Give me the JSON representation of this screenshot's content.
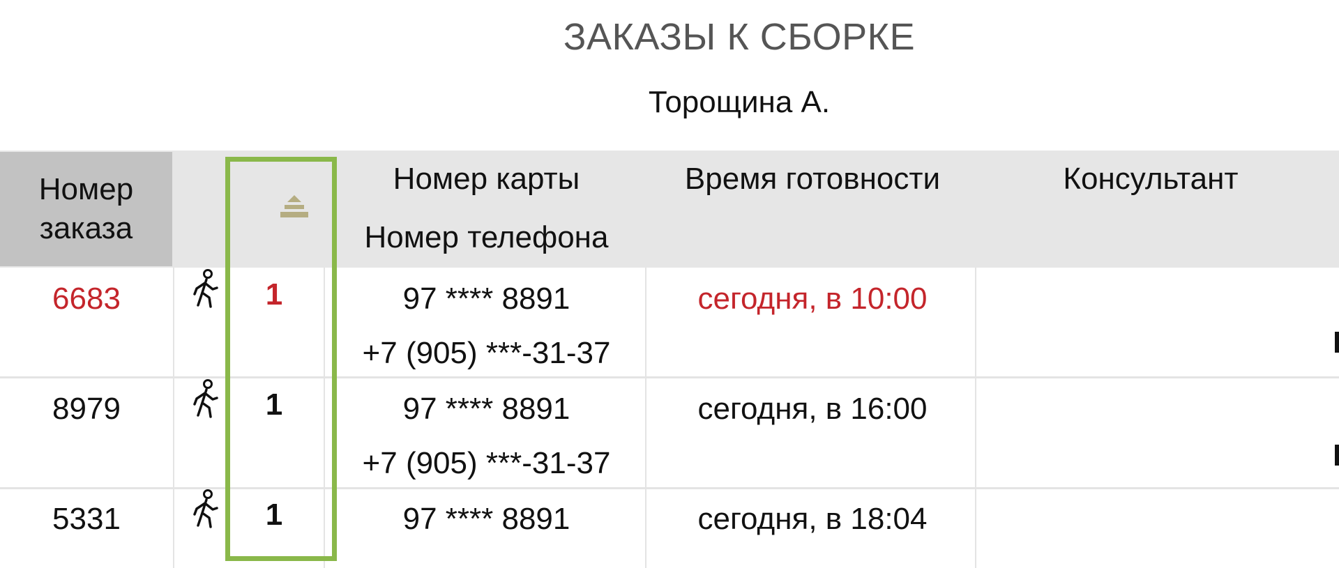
{
  "page": {
    "title": "ЗАКАЗЫ К СБОРКЕ",
    "employee": "Торощина А."
  },
  "table": {
    "headers": {
      "order_number_line1": "Номер",
      "order_number_line2": "заказа",
      "card_number": "Номер карты",
      "phone_number": "Номер телефона",
      "ready_time": "Время готовности",
      "consultant": "Консультант"
    },
    "rows": [
      {
        "order": "6683",
        "icon": "walking-person-icon",
        "count": "1",
        "card": "97 **** 8891",
        "phone": "+7 (905) ***-31-37",
        "ready": "сегодня, в 10:00",
        "consultant": "",
        "urgent": true
      },
      {
        "order": "8979",
        "icon": "walking-person-icon",
        "count": "1",
        "card": "97 **** 8891",
        "phone": "+7 (905) ***-31-37",
        "ready": "сегодня, в 16:00",
        "consultant": "",
        "urgent": false
      },
      {
        "order": "5331",
        "icon": "walking-person-icon",
        "count": "1",
        "card": "97 **** 8891",
        "phone": "",
        "ready": "сегодня, в 18:04",
        "consultant": "",
        "urgent": false
      }
    ]
  },
  "colors": {
    "urgent": "#c4252b",
    "highlight_frame": "#8ab84a",
    "header_bg": "#e6e6e6",
    "order_header_bg": "#c2c2c2",
    "sort_icon": "#b5ad82"
  }
}
